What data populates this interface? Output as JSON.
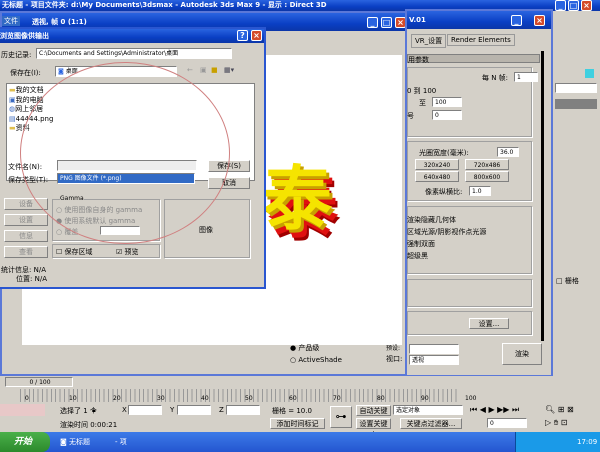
{
  "main_window": {
    "title": "无标题    - 项目文件夹: d:\\My Documents\\3dsmax    - Autodesk 3ds Max 9    - 显示 : Direct 3D"
  },
  "render_frame": {
    "title": "透视, 帧 0 (1:1)",
    "menu_file": "文件",
    "render_text": "泰"
  },
  "save_dialog": {
    "title": "浏览图像供输出",
    "history_label": "历史记录:",
    "history_value": "C:\\Documents and Settings\\Administrator\\桌面",
    "save_in_label": "保存在(I):",
    "save_in_value": "桌面",
    "files": [
      {
        "name": "我的文档",
        "icon": "folder-icon"
      },
      {
        "name": "我的电脑",
        "icon": "computer-icon"
      },
      {
        "name": "网上邻居",
        "icon": "network-icon"
      },
      {
        "name": "44444.png",
        "icon": "image-file-icon"
      },
      {
        "name": "资料",
        "icon": "folder-icon"
      }
    ],
    "filename_label": "文件名(N):",
    "filename_value": "",
    "filetype_label": "保存类型(T):",
    "filetype_value": "PNG 图像文件 (*.png)",
    "save_button": "保存(S)",
    "cancel_button": "取消",
    "side_buttons": [
      "设备",
      "设置",
      "信息",
      "查看"
    ],
    "gamma_title": "Gamma",
    "gamma_options": [
      "使用图像自身的 gamma",
      "使用系统默认 gamma",
      "覆盖"
    ],
    "gamma_selected": 1,
    "save_region": "保存区域",
    "save_region_checked": false,
    "preview": "预览",
    "preview_checked": true,
    "image_label": "图像",
    "stats_label": "统计信息:",
    "stats_value": "N/A",
    "location_label": "位置:",
    "location_value": "N/A"
  },
  "render_setup": {
    "title_suffix": "V.01",
    "tabs": [
      "VR_设置",
      "Render Elements"
    ],
    "rollout": "用参数",
    "every_nth_label": "每 N 帧:",
    "every_nth": "1",
    "range_text": "0 到 100",
    "to_label": "至",
    "to_value": "100",
    "num_label": "号",
    "num_value": "0",
    "aperture_label": "光圈宽度(毫米):",
    "aperture_value": "36.0",
    "sizes": [
      "320x240",
      "720x486",
      "640x480",
      "800x600"
    ],
    "pixel_aspect_label": "像素纵横比:",
    "pixel_aspect_value": "1.0",
    "options": [
      "渲染隐藏几何体",
      "区域光源/阴影视作点光源",
      "强制双面",
      "超级黑"
    ],
    "setup_button": "设置...",
    "mode_product": "产品级",
    "mode_activeshade": "ActiveShade",
    "preset_label": "预设:",
    "viewport_label": "视口:",
    "viewport_value": "透视",
    "render_button": "渲染"
  },
  "command_panel": {
    "grid_label": "栅格"
  },
  "timeline": {
    "frame_counter": "0 / 100",
    "ticks": [
      "0",
      "10",
      "20",
      "30",
      "40",
      "50",
      "60",
      "70",
      "80",
      "90",
      "100"
    ]
  },
  "status": {
    "selected": "选择了 1 个",
    "x_label": "X",
    "y_label": "Y",
    "z_label": "Z",
    "grid": "栅格 = 10.0",
    "render_time": "渲染时间  0:00:21",
    "add_time_tag": "添加时间标记",
    "auto_key": "自动关键点",
    "set_key": "设置关键点",
    "selection_dropdown": "选定对象",
    "key_filters": "关键点过滤器...",
    "frame_value": "0"
  },
  "taskbar": {
    "start": "开始",
    "tasks": [
      "无标题",
      "- 项"
    ],
    "clock": "17:09"
  },
  "colors": {
    "xp_blue": "#0a3fc4",
    "panel_gray": "#d4d0c8",
    "text_yellow": "#f5e400",
    "text_red": "#e01010",
    "selection_blue": "#316ac5",
    "start_green": "#3c9a3c"
  }
}
